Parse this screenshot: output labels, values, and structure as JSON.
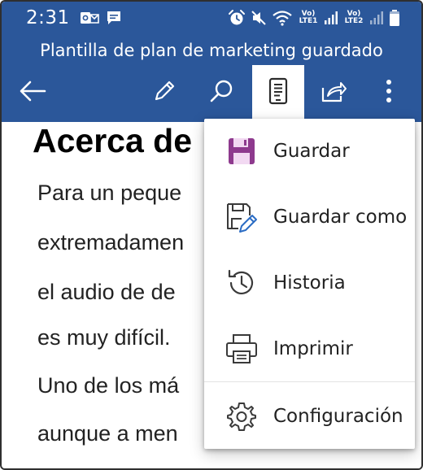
{
  "status_bar": {
    "time": "2:31",
    "lte1": "Vo) LTE1",
    "lte2": "Vo) LTE2",
    "icons": [
      "outlook-icon",
      "message-icon",
      "alarm-icon",
      "mute-icon",
      "wifi-icon",
      "signal-icon",
      "battery-icon"
    ]
  },
  "header": {
    "title": "Plantilla de plan de marketing guardado"
  },
  "toolbar": {
    "buttons": [
      {
        "name": "back",
        "icon": "back-arrow-icon"
      },
      {
        "name": "edit",
        "icon": "pencil-icon"
      },
      {
        "name": "search",
        "icon": "search-icon"
      },
      {
        "name": "mobile-view",
        "icon": "mobile-view-icon",
        "active": true
      },
      {
        "name": "share",
        "icon": "share-icon"
      },
      {
        "name": "more",
        "icon": "more-vertical-icon"
      }
    ]
  },
  "document": {
    "heading": "Acerca de",
    "lines": [
      "Para un peque",
      "extremadamen",
      "el audio de de",
      "es muy difícil.",
      "Uno de los má",
      "aunque a men"
    ]
  },
  "menu": {
    "items": [
      {
        "label": "Guardar",
        "icon": "save-icon"
      },
      {
        "label": "Guardar como",
        "icon": "save-as-icon"
      },
      {
        "label": "Historia",
        "icon": "history-icon"
      },
      {
        "label": "Imprimir",
        "icon": "print-icon"
      },
      {
        "label": "Configuración",
        "icon": "settings-gear-icon"
      }
    ]
  },
  "colors": {
    "brand_blue": "#2b579a",
    "save_icon_purple": "#8e3a8e",
    "pencil_blue": "#2b6cc4"
  }
}
